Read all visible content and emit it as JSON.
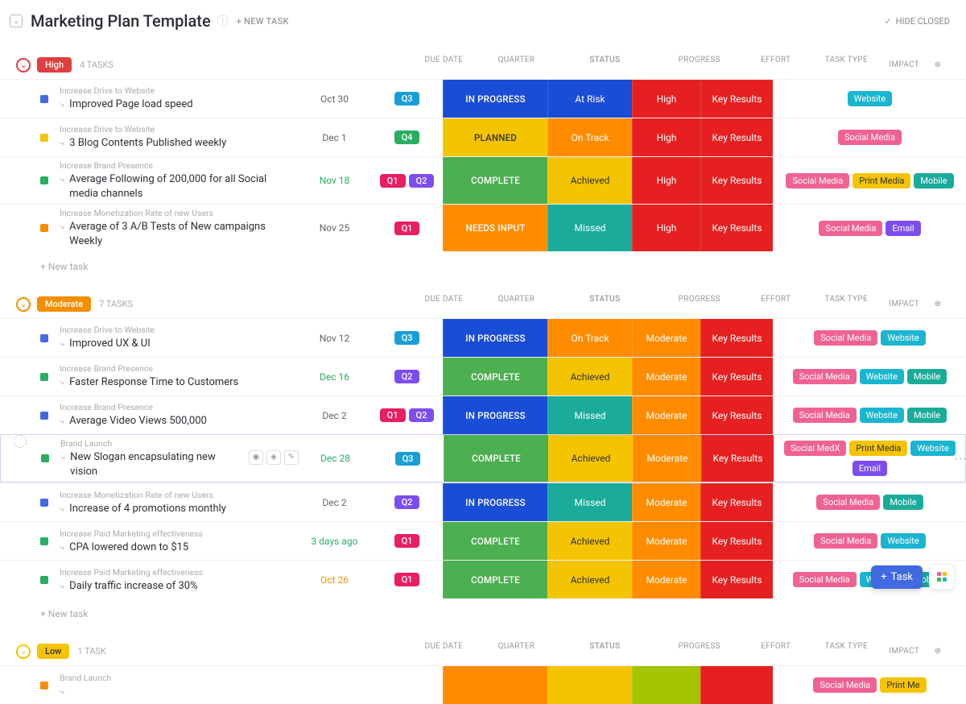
{
  "header": {
    "title": "Marketing Plan Template",
    "new_task": "+ NEW TASK",
    "hide_closed": "HIDE CLOSED"
  },
  "columns": {
    "due_date": "DUE DATE",
    "quarter": "QUARTER",
    "status": "STATUS",
    "progress": "PROGRESS",
    "effort": "EFFORT",
    "task_type": "TASK TYPE",
    "impact": "IMPACT"
  },
  "new_task_row": "+ New task",
  "fab": {
    "task": "Task"
  },
  "groups": [
    {
      "name": "High",
      "color": "high",
      "toggle_color": "red",
      "count": "4 TASKS",
      "tasks": [
        {
          "sq": "blue",
          "category": "Increase Drive to Website",
          "title": "Improved Page load speed",
          "due": "Oct 30",
          "due_color": "",
          "quarters": [
            "Q3"
          ],
          "status": "IN PROGRESS",
          "status_bg": "bg-blue",
          "progress": "At Risk",
          "progress_bg": "bg-blue",
          "effort": "High",
          "effort_bg": "bg-red",
          "tasktype": "Key Results",
          "tasktype_bg": "bg-red",
          "impact": [
            {
              "t": "Website",
              "c": "website"
            }
          ]
        },
        {
          "sq": "yellow",
          "category": "Increase Drive to Website",
          "title": "3 Blog Contents Published weekly",
          "due": "Dec 1",
          "due_color": "",
          "quarters": [
            "Q4"
          ],
          "status": "PLANNED",
          "status_bg": "bg-yellow",
          "progress": "On Track",
          "progress_bg": "bg-darkorange",
          "effort": "High",
          "effort_bg": "bg-red",
          "tasktype": "Key Results",
          "tasktype_bg": "bg-red",
          "impact": [
            {
              "t": "Social Media",
              "c": "social"
            }
          ]
        },
        {
          "sq": "green",
          "category": "Increase Brand Presence",
          "title": "Average Following of 200,000 for all Social media channels",
          "due": "Nov 18",
          "due_color": "green",
          "quarters": [
            "Q1",
            "Q2"
          ],
          "status": "COMPLETE",
          "status_bg": "bg-green",
          "progress": "Achieved",
          "progress_bg": "bg-yellow",
          "effort": "High",
          "effort_bg": "bg-red",
          "tasktype": "Key Results",
          "tasktype_bg": "bg-red",
          "impact": [
            {
              "t": "Social Media",
              "c": "social"
            },
            {
              "t": "Print Media",
              "c": "print"
            },
            {
              "t": "Mobile",
              "c": "mobile"
            }
          ]
        },
        {
          "sq": "orange",
          "category": "Increase Monetization Rate of new Users",
          "title": "Average of 3 A/B Tests of New campaigns Weekly",
          "due": "Nov 25",
          "due_color": "",
          "quarters": [
            "Q1"
          ],
          "status": "NEEDS INPUT",
          "status_bg": "bg-orange",
          "progress": "Missed",
          "progress_bg": "bg-teal",
          "effort": "High",
          "effort_bg": "bg-red",
          "tasktype": "Key Results",
          "tasktype_bg": "bg-red",
          "impact": [
            {
              "t": "Social Media",
              "c": "social"
            },
            {
              "t": "Email",
              "c": "email"
            }
          ]
        }
      ]
    },
    {
      "name": "Moderate",
      "color": "moderate",
      "toggle_color": "orange",
      "count": "7 TASKS",
      "tasks": [
        {
          "sq": "blue",
          "category": "Increase Drive to Website",
          "title": "Improved UX & UI",
          "due": "Nov 12",
          "due_color": "",
          "quarters": [
            "Q3"
          ],
          "status": "IN PROGRESS",
          "status_bg": "bg-blue",
          "progress": "On Track",
          "progress_bg": "bg-darkorange",
          "effort": "Moderate",
          "effort_bg": "bg-darkorange",
          "tasktype": "Key Results",
          "tasktype_bg": "bg-red",
          "impact": [
            {
              "t": "Social Media",
              "c": "social"
            },
            {
              "t": "Website",
              "c": "website"
            }
          ]
        },
        {
          "sq": "green",
          "category": "Increase Brand Presence",
          "title": "Faster Response Time to Customers",
          "due": "Dec 16",
          "due_color": "green",
          "quarters": [
            "Q2"
          ],
          "status": "COMPLETE",
          "status_bg": "bg-green",
          "progress": "Achieved",
          "progress_bg": "bg-yellow",
          "effort": "Moderate",
          "effort_bg": "bg-darkorange",
          "tasktype": "Key Results",
          "tasktype_bg": "bg-red",
          "impact": [
            {
              "t": "Social Media",
              "c": "social"
            },
            {
              "t": "Website",
              "c": "website"
            },
            {
              "t": "Mobile",
              "c": "mobile"
            }
          ]
        },
        {
          "sq": "blue",
          "category": "Increase Brand Presence",
          "title": "Average Video Views 500,000",
          "due": "Dec 2",
          "due_color": "",
          "quarters": [
            "Q1",
            "Q2"
          ],
          "status": "IN PROGRESS",
          "status_bg": "bg-blue",
          "progress": "Missed",
          "progress_bg": "bg-teal",
          "effort": "Moderate",
          "effort_bg": "bg-darkorange",
          "tasktype": "Key Results",
          "tasktype_bg": "bg-red",
          "impact": [
            {
              "t": "Social Media",
              "c": "social"
            },
            {
              "t": "Website",
              "c": "website"
            },
            {
              "t": "Mobile",
              "c": "mobile"
            }
          ]
        },
        {
          "sq": "green",
          "category": "Brand Launch",
          "title": "New Slogan encapsulating new vision",
          "due": "Dec 28",
          "due_color": "green",
          "quarters": [
            "Q3"
          ],
          "status": "COMPLETE",
          "status_bg": "bg-green",
          "progress": "Achieved",
          "progress_bg": "bg-yellow",
          "effort": "Moderate",
          "effort_bg": "bg-darkorange",
          "tasktype": "Key Results",
          "tasktype_bg": "bg-red",
          "impact": [
            {
              "t": "Social MedX",
              "c": "social"
            },
            {
              "t": "Print Media",
              "c": "print"
            },
            {
              "t": "Website",
              "c": "website"
            },
            {
              "t": "Email",
              "c": "email"
            }
          ],
          "hover": true
        },
        {
          "sq": "blue",
          "category": "Increase Monetization Rate of new Users",
          "title": "Increase of 4 promotions monthly",
          "due": "Dec 2",
          "due_color": "",
          "quarters": [
            "Q2"
          ],
          "status": "IN PROGRESS",
          "status_bg": "bg-blue",
          "progress": "Missed",
          "progress_bg": "bg-teal",
          "effort": "Moderate",
          "effort_bg": "bg-darkorange",
          "tasktype": "Key Results",
          "tasktype_bg": "bg-red",
          "impact": [
            {
              "t": "Social Media",
              "c": "social"
            },
            {
              "t": "Mobile",
              "c": "mobile"
            }
          ]
        },
        {
          "sq": "green",
          "category": "Increase Paid Marketing effectiveness",
          "title": "CPA lowered down to $15",
          "due": "3 days ago",
          "due_color": "green",
          "quarters": [
            "Q1"
          ],
          "status": "COMPLETE",
          "status_bg": "bg-green",
          "progress": "Achieved",
          "progress_bg": "bg-yellow",
          "effort": "Moderate",
          "effort_bg": "bg-darkorange",
          "tasktype": "Key Results",
          "tasktype_bg": "bg-red",
          "impact": [
            {
              "t": "Social Media",
              "c": "social"
            },
            {
              "t": "Website",
              "c": "website"
            }
          ]
        },
        {
          "sq": "green",
          "category": "Increase Paid Marketing effectiveness",
          "title": "Daily traffic increase of 30%",
          "due": "Oct 26",
          "due_color": "orange",
          "quarters": [
            "Q1"
          ],
          "status": "COMPLETE",
          "status_bg": "bg-green",
          "progress": "Achieved",
          "progress_bg": "bg-yellow",
          "effort": "Moderate",
          "effort_bg": "bg-darkorange",
          "tasktype": "Key Results",
          "tasktype_bg": "bg-red",
          "impact": [
            {
              "t": "Social Media",
              "c": "social"
            },
            {
              "t": "Website",
              "c": "website"
            },
            {
              "t": "Mobile",
              "c": "mobile"
            }
          ]
        }
      ]
    },
    {
      "name": "Low",
      "color": "low",
      "toggle_color": "yellow",
      "count": "1 TASK",
      "tasks": [
        {
          "sq": "orange",
          "category": "Brand Launch",
          "title": "",
          "due": "",
          "due_color": "",
          "quarters": [],
          "status": "",
          "status_bg": "bg-orange",
          "progress": "",
          "progress_bg": "bg-yellow",
          "effort": "",
          "effort_bg": "bg-yellowg",
          "tasktype": "",
          "tasktype_bg": "bg-red",
          "impact": [
            {
              "t": "Social Media",
              "c": "social"
            },
            {
              "t": "Print Me",
              "c": "print"
            }
          ],
          "partial": true
        }
      ]
    }
  ]
}
